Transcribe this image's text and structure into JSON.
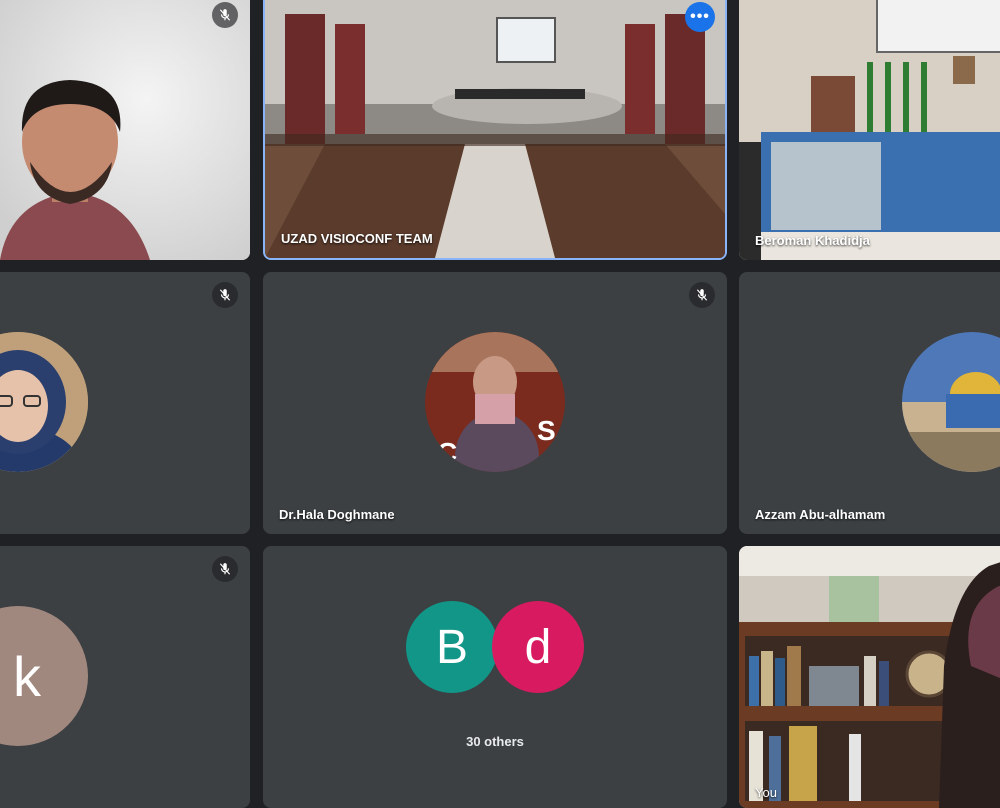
{
  "participants": [
    {
      "name": "",
      "muted": true
    },
    {
      "name": "UZAD VISIOCONF TEAM",
      "muted": false,
      "pinned": true
    },
    {
      "name": "Beroman Khadidja",
      "muted": false
    },
    {
      "name": "",
      "muted": true
    },
    {
      "name": "Dr.Hala Doghmane",
      "muted": true
    },
    {
      "name": "Azzam Abu-alhamam",
      "muted": false
    },
    {
      "name": "",
      "muted": true,
      "initial": "k",
      "avatar_color": "#a1887f"
    },
    {
      "name": "You",
      "muted": false
    }
  ],
  "others_tile": {
    "initials": [
      {
        "letter": "B",
        "color": "#129688"
      },
      {
        "letter": "d",
        "color": "#d81b60"
      }
    ],
    "label": "30 others"
  },
  "more_options_glyph": "•••",
  "icons": {
    "mic_off": "mic-off-icon",
    "more": "more-options-icon"
  },
  "colors": {
    "background": "#202124",
    "tile": "#3c4043",
    "active_border": "#8ab4f8",
    "more_button": "#1a73e8"
  }
}
